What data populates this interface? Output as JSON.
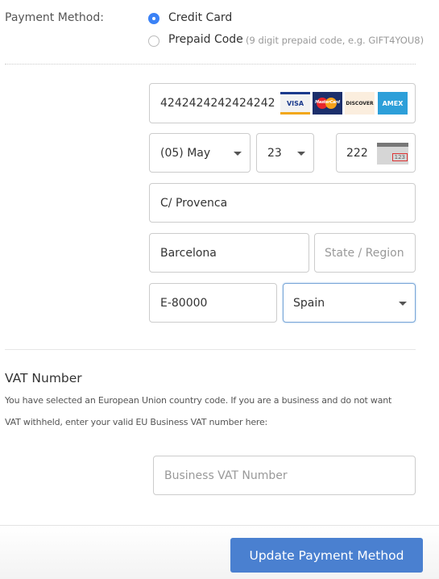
{
  "payment_method": {
    "label": "Payment Method:",
    "options": [
      {
        "label": "Credit Card",
        "selected": true
      },
      {
        "label": "Prepaid Code",
        "hint": "(9 digit prepaid code, e.g. GIFT4YOU8)",
        "selected": false
      }
    ]
  },
  "card": {
    "number": "4242424242424242",
    "brands": [
      "VISA",
      "MasterCard",
      "DISCOVER",
      "AMEX"
    ],
    "exp_month": "(05) May",
    "exp_year": "23",
    "cvc": "222",
    "cvc_icon_text": "123",
    "address": "C/ Provenca",
    "city": "Barcelona",
    "state_placeholder": "State / Region",
    "zip": "E-80000",
    "country": "Spain"
  },
  "vat": {
    "title": "VAT Number",
    "line1": "You have selected an European Union country code. If you are a business and do not want",
    "line2": "VAT withheld, enter your valid EU Business VAT number here:",
    "placeholder": "Business VAT Number"
  },
  "footer": {
    "submit_label": "Update Payment Method",
    "accent": "#4a80d0"
  }
}
